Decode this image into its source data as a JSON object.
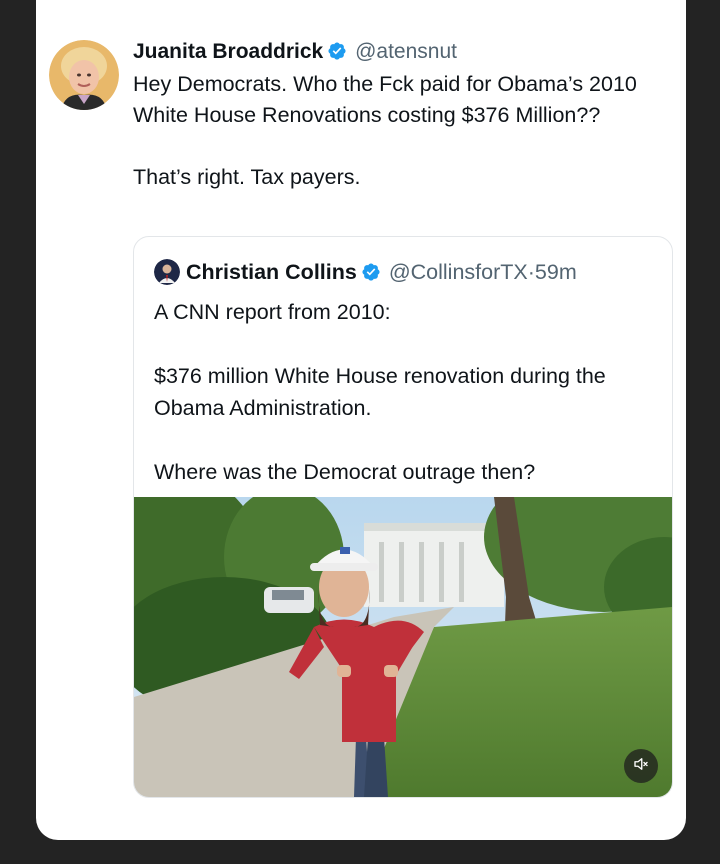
{
  "tweet": {
    "author_name": "Juanita Broaddrick",
    "author_handle": "@atensnut",
    "paragraphs": [
      "Hey Democrats.  Who the Fck paid for Obama’s 2010 White House Renovations costing $376 Million??",
      "That’s right.  Tax payers."
    ]
  },
  "quoted_tweet": {
    "author_name": "Christian Collins",
    "author_handle": "@CollinsforTX",
    "separator": "·",
    "time_ago": "59m",
    "paragraphs": [
      "A CNN report from 2010:",
      "$376 million White House renovation during the Obama Administration.",
      "Where was the Democrat outrage then?"
    ],
    "media": {
      "type": "video",
      "icons": [
        "volume-muted-icon"
      ]
    }
  },
  "colors": {
    "background": "#232323",
    "card": "#ffffff",
    "text": "#0f1419",
    "secondary_text": "#536471",
    "verified_blue": "#1d9bf0"
  }
}
